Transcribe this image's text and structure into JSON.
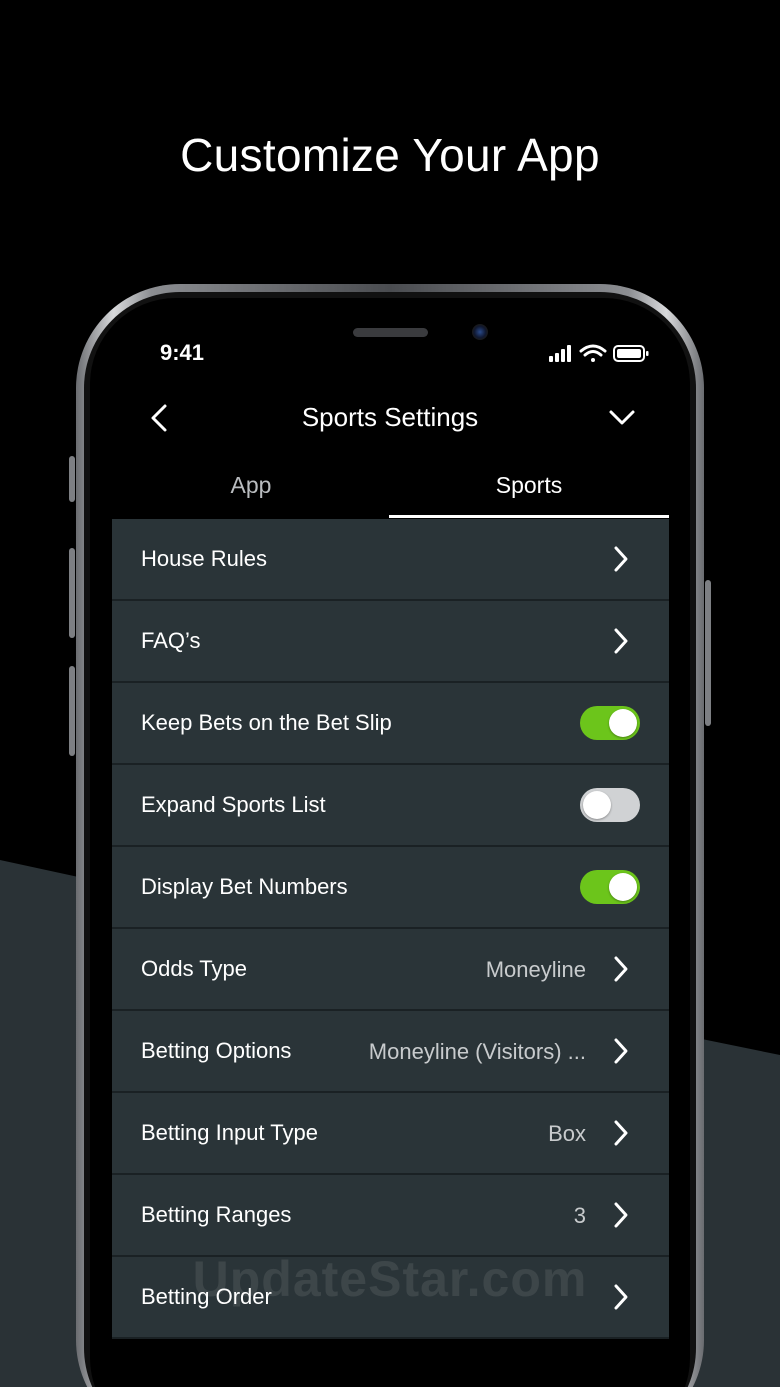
{
  "headline": "Customize Your App",
  "status_bar": {
    "time": "9:41"
  },
  "nav": {
    "title": "Sports Settings"
  },
  "tabs": [
    {
      "label": "App",
      "active": false
    },
    {
      "label": "Sports",
      "active": true
    }
  ],
  "rows": [
    {
      "label": "House Rules",
      "control": "chevron"
    },
    {
      "label": "FAQ’s",
      "control": "chevron"
    },
    {
      "label": "Keep Bets on the Bet Slip",
      "control": "toggle",
      "on": true
    },
    {
      "label": "Expand Sports List",
      "control": "toggle",
      "on": false
    },
    {
      "label": "Display Bet Numbers",
      "control": "toggle",
      "on": true
    },
    {
      "label": "Odds Type",
      "value": "Moneyline",
      "control": "chevron"
    },
    {
      "label": "Betting Options",
      "value": "Moneyline (Visitors) ...",
      "control": "chevron"
    },
    {
      "label": "Betting Input Type",
      "value": "Box",
      "control": "chevron"
    },
    {
      "label": "Betting Ranges",
      "value": "3",
      "control": "chevron"
    },
    {
      "label": "Betting Order",
      "control": "chevron"
    }
  ],
  "watermark": "UpdateStar.com",
  "colors": {
    "background": "#000000",
    "row_bg": "#2a3438",
    "toggle_on": "#6cc51b",
    "toggle_off": "#d0d2d4"
  },
  "icons": {
    "back": "chevron-left-icon",
    "dropdown": "chevron-down-icon",
    "row_arrow": "chevron-right-icon",
    "signal": "cellular-signal-icon",
    "wifi": "wifi-icon",
    "battery": "battery-icon"
  }
}
